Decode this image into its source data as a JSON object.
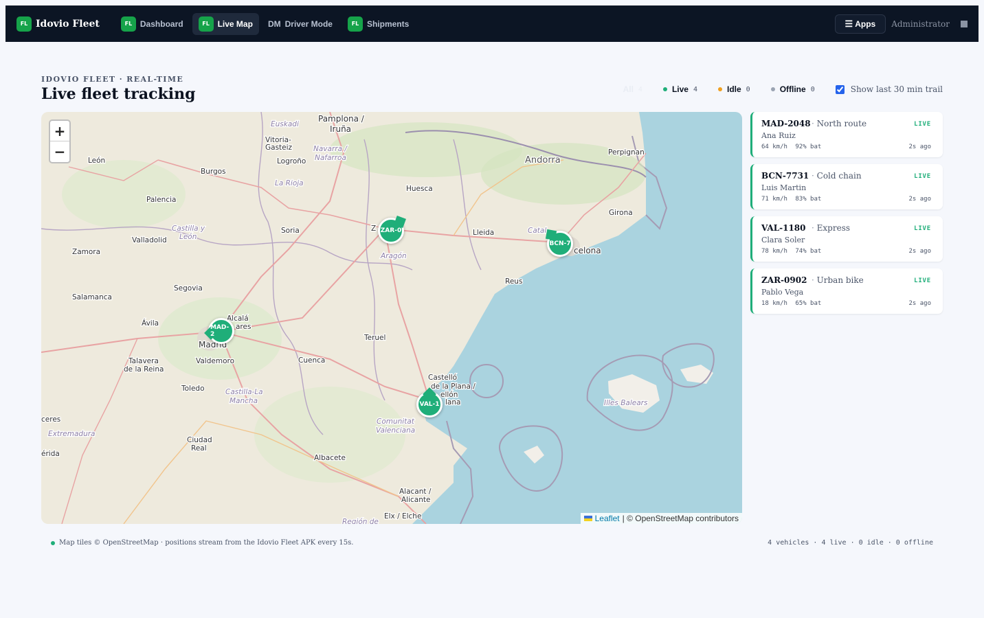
{
  "brand": {
    "badge": "FL",
    "name": "Idovio Fleet"
  },
  "nav": {
    "dashboard": {
      "badge": "FL",
      "label": "Dashboard"
    },
    "live_map": {
      "badge": "FL",
      "label": "Live Map"
    },
    "driver_mode": {
      "prefix": "DM",
      "label": "Driver Mode"
    },
    "shipments": {
      "badge": "FL",
      "label": "Shipments"
    },
    "active": "Live Map"
  },
  "header_right": {
    "apps_icon": "hamburger-icon",
    "apps_label": "Apps",
    "user": "Administrator"
  },
  "page": {
    "kicker": "IDOVIO FLEET · REAL-TIME",
    "title": "Live fleet tracking"
  },
  "filters": {
    "all": {
      "label": "All",
      "count": "4"
    },
    "live": {
      "label": "Live",
      "count": "4",
      "color": "#1fae79"
    },
    "idle": {
      "label": "Idle",
      "count": "0",
      "color": "#f0a020"
    },
    "offline": {
      "label": "Offline",
      "count": "0",
      "color": "#9aa3b2"
    },
    "trail": {
      "label": "Show last 30 min trail",
      "checked": true
    }
  },
  "map": {
    "zoom_in": "+",
    "zoom_out": "−",
    "attribution_link": "Leaflet",
    "attribution_text": "| © OpenStreetMap contributors",
    "labels": {
      "pamplona": "Pamplona /",
      "iruna": "Iruña",
      "euskadi": "Euskadi",
      "vitoria": "Vitoria-",
      "gasteiz": "Gasteiz",
      "navarra": "Navarra /",
      "nafarroa": "Nafarroa",
      "leon": "León",
      "burgos": "Burgos",
      "logrono": "Logroño",
      "la_rioja": "La Rioja",
      "huesca": "Huesca",
      "andorra": "Andorra",
      "perpignan": "Perpignan",
      "palencia": "Palencia",
      "castilla": "Castilla y",
      "leon_region": "León",
      "valladolid": "Valladolid",
      "soria": "Soria",
      "lleida": "Lleida",
      "girona": "Girona",
      "cataluna": "Catal",
      "barcelona": "celona",
      "zamora": "Zamora",
      "zaragoza": "Z",
      "aragon": "Aragón",
      "segovia": "Segovia",
      "reus": "Reus",
      "salamanca": "Salamanca",
      "alcala": "Alcalá",
      "henares": "ares",
      "avila": "Ávila",
      "madrid": "Madrid",
      "teruel": "Teruel",
      "talavera": "Talavera",
      "de_la_reina": "de la Reina",
      "valdemoro": "Valdemoro",
      "cuenca": "Cuenca",
      "castello": "Castelló",
      "de_la_plana": "de la Plana /",
      "castellon": "ellón",
      "plana": "lana",
      "toledo": "Toledo",
      "castilla_la": "Castilla-La",
      "mancha": "Mancha",
      "illes_balears": "Illes Balears",
      "caceres": "ceres",
      "extremadura": "Extremadura",
      "comunitat": "Comunitat",
      "valenciana": "Valenciana",
      "ciudad": "Ciudad",
      "real": "Real",
      "merida": "érida",
      "albacete": "Albacete",
      "alacant": "Alacant /",
      "alicante": "Alicante",
      "elche": "Elx / Elche",
      "region_de": "Región de"
    },
    "markers": {
      "zar": "ZAR-0",
      "bcn": "BCN-7",
      "mad": "MAD-2",
      "val": "VAL-1"
    }
  },
  "vehicles": [
    {
      "id": "MAD-2048",
      "route": "North route",
      "driver": "Ana Ruiz",
      "speed": "64 km/h",
      "battery": "92% bat",
      "status": "LIVE",
      "ago": "2s ago"
    },
    {
      "id": "BCN-7731",
      "route": "Cold chain",
      "driver": "Luis Martin",
      "speed": "71 km/h",
      "battery": "83% bat",
      "status": "LIVE",
      "ago": "2s ago"
    },
    {
      "id": "VAL-1180",
      "route": "Express",
      "driver": "Clara Soler",
      "speed": "78 km/h",
      "battery": "74% bat",
      "status": "LIVE",
      "ago": "2s ago"
    },
    {
      "id": "ZAR-0902",
      "route": "Urban bike",
      "driver": "Pablo Vega",
      "speed": "18 km/h",
      "battery": "65% bat",
      "status": "LIVE",
      "ago": "2s ago"
    }
  ],
  "footer": {
    "note": "Map tiles © OpenStreetMap · positions stream from the Idovio Fleet APK every 15s.",
    "stats": "4 vehicles · 4 live · 0 idle · 0 offline"
  },
  "colors": {
    "accent": "#1fae79",
    "nav_bg": "#0c1524",
    "page_bg": "#f5f7fc",
    "sea": "#aad3df"
  }
}
